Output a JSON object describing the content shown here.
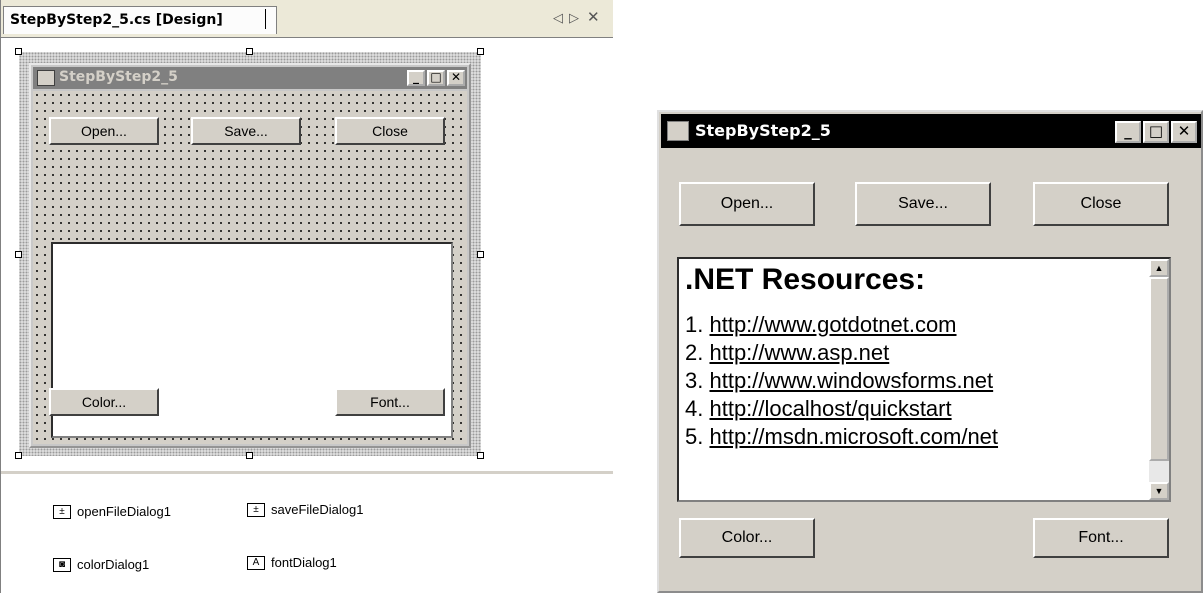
{
  "designer": {
    "tab_title": "StepByStep2_5.cs [Design]",
    "tab_controls": {
      "prev": "◁",
      "next": "▷",
      "close": "✕"
    },
    "form": {
      "title": "StepByStep2_5",
      "buttons": {
        "open": "Open...",
        "save": "Save...",
        "close": "Close",
        "color": "Color...",
        "font": "Font..."
      }
    },
    "tray": {
      "components": [
        {
          "label": "openFileDialog1",
          "icon": "open-file-dialog-icon"
        },
        {
          "label": "saveFileDialog1",
          "icon": "save-file-dialog-icon"
        },
        {
          "label": "colorDialog1",
          "icon": "color-dialog-icon"
        },
        {
          "label": "fontDialog1",
          "icon": "font-dialog-icon"
        }
      ]
    }
  },
  "runtime": {
    "title": "StepByStep2_5",
    "buttons": {
      "open": "Open...",
      "save": "Save...",
      "close": "Close",
      "color": "Color...",
      "font": "Font..."
    },
    "richtext": {
      "heading": ".NET Resources:",
      "items": [
        {
          "num": "1.",
          "url": "http://www.gotdotnet.com"
        },
        {
          "num": "2.",
          "url": "http://www.asp.net"
        },
        {
          "num": "3.",
          "url": "http://www.windowsforms.net"
        },
        {
          "num": "4.",
          "url": "http://localhost/quickstart"
        },
        {
          "num": "5.",
          "url": "http://msdn.microsoft.com/net"
        }
      ]
    }
  },
  "colors": {
    "design_title_bg": "#808080",
    "runtime_title_bg": "#000000",
    "face": "#d4d0c8"
  }
}
